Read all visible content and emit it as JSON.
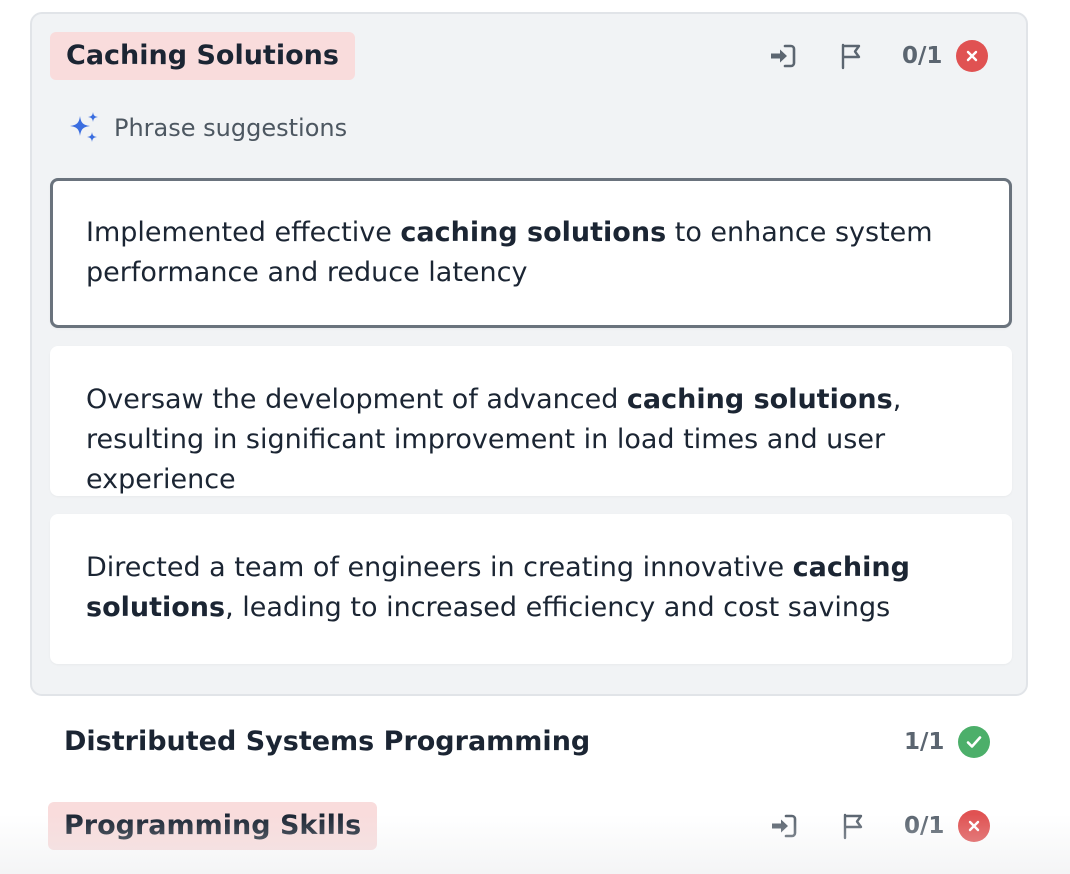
{
  "active_keyword": {
    "label": "Caching Solutions",
    "count": "0/1",
    "status": "missing",
    "suggestions_heading": "Phrase suggestions",
    "suggestions": [
      {
        "before": "Implemented effective ",
        "keyword": "caching solutions",
        "after": " to enhance system performance and reduce latency",
        "selected": true
      },
      {
        "before": "Oversaw the development of advanced ",
        "keyword": "caching solutions",
        "after": ", resulting in significant improvement in load times and user experience",
        "selected": false
      },
      {
        "before": "Directed a team of engineers in creating innovative ",
        "keyword": "caching solutions",
        "after": ", leading to increased efficiency and cost savings",
        "selected": false
      }
    ]
  },
  "other_keywords": [
    {
      "label": "Distributed Systems Programming",
      "count": "1/1",
      "status": "found"
    },
    {
      "label": "Programming Skills",
      "count": "0/1",
      "status": "missing"
    }
  ],
  "colors": {
    "missing_tag_bg": "#f9dcdc",
    "status_missing": "#e05252",
    "status_found": "#4caf6a",
    "sparkle": "#3b6ee0"
  },
  "icons": {
    "insert": "sign-in-arrow-icon",
    "flag": "flag-icon",
    "missing": "x-circle-icon",
    "found": "check-circle-icon",
    "suggest": "sparkles-icon"
  }
}
